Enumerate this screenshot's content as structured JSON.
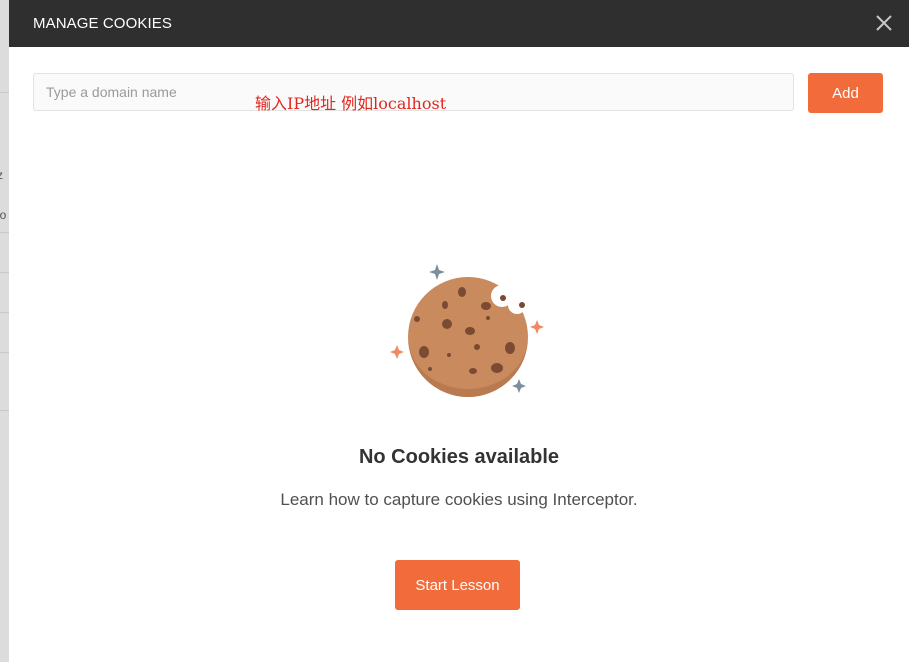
{
  "modal": {
    "title": "MANAGE COOKIES"
  },
  "domain_input": {
    "placeholder": "Type a domain name",
    "value": ""
  },
  "annotation": {
    "text": "输入IP地址 例如localhost"
  },
  "add_button": {
    "label": "Add"
  },
  "empty_state": {
    "title": "No Cookies available",
    "description": "Learn how to capture cookies using Interceptor.",
    "button_label": "Start Lesson"
  },
  "icons": {
    "close": "close-icon",
    "cookie": "cookie-illustration",
    "sparkle": "sparkle-icon"
  },
  "colors": {
    "header_bg": "#2f2f2f",
    "accent": "#f26b3a",
    "cookie": "#c98a5e",
    "annotation": "#e0271e"
  }
}
